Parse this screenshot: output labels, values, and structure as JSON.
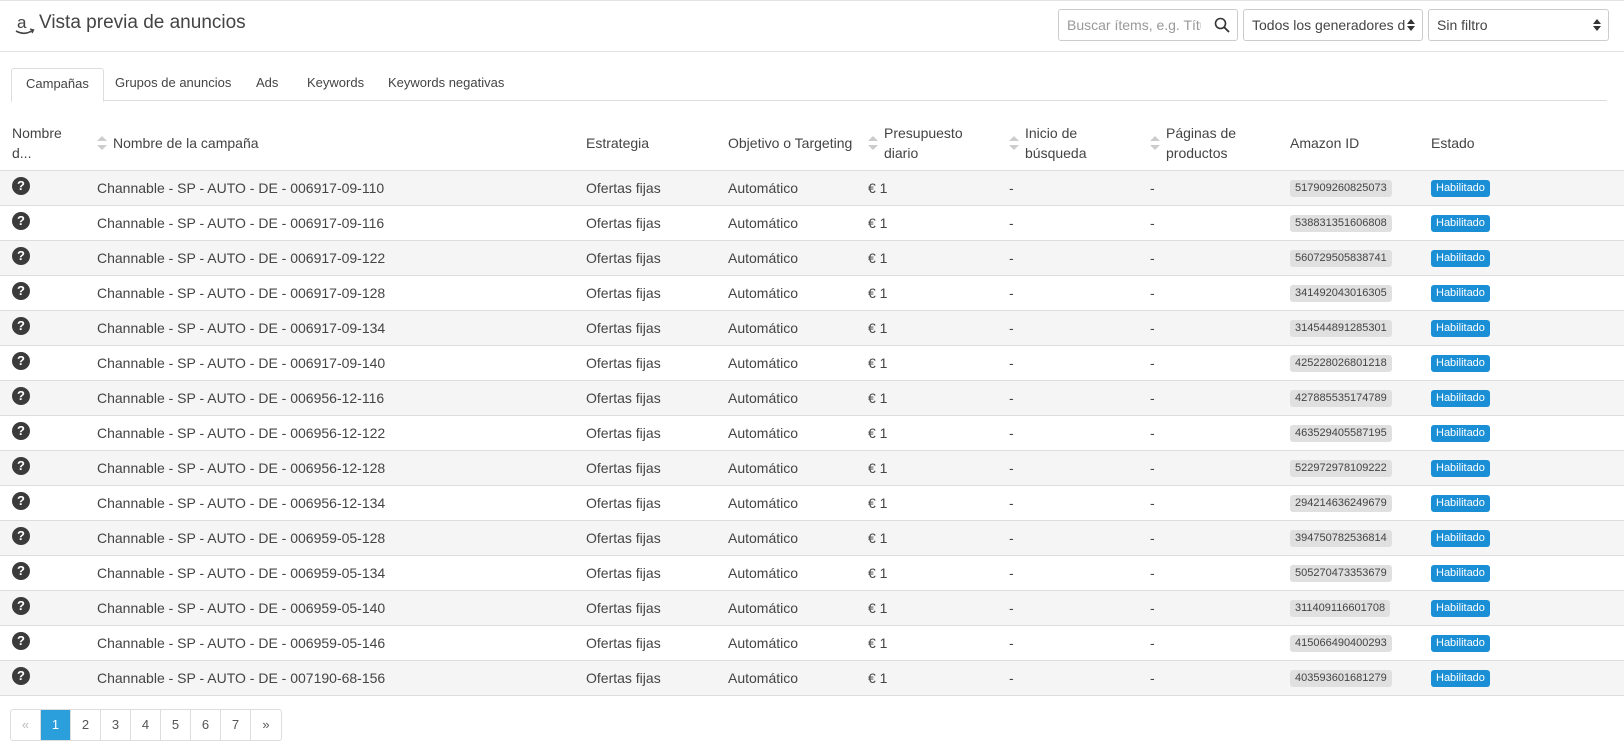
{
  "header": {
    "title": "Vista previa de anuncios",
    "search_placeholder": "Buscar ítems, e.g. Título d",
    "generator_select": "Todos los generadores d",
    "filter_select": "Sin filtro"
  },
  "tabs": [
    "Campañas",
    "Grupos de anuncios",
    "Ads",
    "Keywords",
    "Keywords negativas"
  ],
  "active_tab": "Campañas",
  "columns": {
    "nombre_d": "Nombre d...",
    "campaign": "Nombre de la campaña",
    "strategy": "Estrategia",
    "target": "Objetivo o Targeting",
    "budget_1": "Presupuesto",
    "budget_2": "diario",
    "search_1": "Inicio de",
    "search_2": "búsqueda",
    "pages_1": "Páginas de",
    "pages_2": "productos",
    "amazon_id": "Amazon ID",
    "status": "Estado"
  },
  "rows": [
    {
      "campaign": "Channable - SP - AUTO - DE - 006917-09-110",
      "strategy": "Ofertas fijas",
      "target": "Automático",
      "budget": "€ 1",
      "search": "-",
      "pages": "-",
      "amazon_id": "517909260825073",
      "status": "Habilitado"
    },
    {
      "campaign": "Channable - SP - AUTO - DE - 006917-09-116",
      "strategy": "Ofertas fijas",
      "target": "Automático",
      "budget": "€ 1",
      "search": "-",
      "pages": "-",
      "amazon_id": "538831351606808",
      "status": "Habilitado"
    },
    {
      "campaign": "Channable - SP - AUTO - DE - 006917-09-122",
      "strategy": "Ofertas fijas",
      "target": "Automático",
      "budget": "€ 1",
      "search": "-",
      "pages": "-",
      "amazon_id": "560729505838741",
      "status": "Habilitado"
    },
    {
      "campaign": "Channable - SP - AUTO - DE - 006917-09-128",
      "strategy": "Ofertas fijas",
      "target": "Automático",
      "budget": "€ 1",
      "search": "-",
      "pages": "-",
      "amazon_id": "341492043016305",
      "status": "Habilitado"
    },
    {
      "campaign": "Channable - SP - AUTO - DE - 006917-09-134",
      "strategy": "Ofertas fijas",
      "target": "Automático",
      "budget": "€ 1",
      "search": "-",
      "pages": "-",
      "amazon_id": "314544891285301",
      "status": "Habilitado"
    },
    {
      "campaign": "Channable - SP - AUTO - DE - 006917-09-140",
      "strategy": "Ofertas fijas",
      "target": "Automático",
      "budget": "€ 1",
      "search": "-",
      "pages": "-",
      "amazon_id": "425228026801218",
      "status": "Habilitado"
    },
    {
      "campaign": "Channable - SP - AUTO - DE - 006956-12-116",
      "strategy": "Ofertas fijas",
      "target": "Automático",
      "budget": "€ 1",
      "search": "-",
      "pages": "-",
      "amazon_id": "427885535174789",
      "status": "Habilitado"
    },
    {
      "campaign": "Channable - SP - AUTO - DE - 006956-12-122",
      "strategy": "Ofertas fijas",
      "target": "Automático",
      "budget": "€ 1",
      "search": "-",
      "pages": "-",
      "amazon_id": "463529405587195",
      "status": "Habilitado"
    },
    {
      "campaign": "Channable - SP - AUTO - DE - 006956-12-128",
      "strategy": "Ofertas fijas",
      "target": "Automático",
      "budget": "€ 1",
      "search": "-",
      "pages": "-",
      "amazon_id": "522972978109222",
      "status": "Habilitado"
    },
    {
      "campaign": "Channable - SP - AUTO - DE - 006956-12-134",
      "strategy": "Ofertas fijas",
      "target": "Automático",
      "budget": "€ 1",
      "search": "-",
      "pages": "-",
      "amazon_id": "294214636249679",
      "status": "Habilitado"
    },
    {
      "campaign": "Channable - SP - AUTO - DE - 006959-05-128",
      "strategy": "Ofertas fijas",
      "target": "Automático",
      "budget": "€ 1",
      "search": "-",
      "pages": "-",
      "amazon_id": "394750782536814",
      "status": "Habilitado"
    },
    {
      "campaign": "Channable - SP - AUTO - DE - 006959-05-134",
      "strategy": "Ofertas fijas",
      "target": "Automático",
      "budget": "€ 1",
      "search": "-",
      "pages": "-",
      "amazon_id": "505270473353679",
      "status": "Habilitado"
    },
    {
      "campaign": "Channable - SP - AUTO - DE - 006959-05-140",
      "strategy": "Ofertas fijas",
      "target": "Automático",
      "budget": "€ 1",
      "search": "-",
      "pages": "-",
      "amazon_id": "311409116601708",
      "status": "Habilitado"
    },
    {
      "campaign": "Channable - SP - AUTO - DE - 006959-05-146",
      "strategy": "Ofertas fijas",
      "target": "Automático",
      "budget": "€ 1",
      "search": "-",
      "pages": "-",
      "amazon_id": "415066490400293",
      "status": "Habilitado"
    },
    {
      "campaign": "Channable - SP - AUTO - DE - 007190-68-156",
      "strategy": "Ofertas fijas",
      "target": "Automático",
      "budget": "€ 1",
      "search": "-",
      "pages": "-",
      "amazon_id": "403593601681279",
      "status": "Habilitado"
    }
  ],
  "help_glyph": "?",
  "pagination": {
    "prev": "«",
    "pages": [
      "1",
      "2",
      "3",
      "4",
      "5",
      "6",
      "7"
    ],
    "current": "1",
    "next": "»"
  },
  "colors": {
    "status_badge": "#1a8fd6",
    "active_page": "#2a9fdc",
    "id_badge": "#e0e0e0"
  }
}
